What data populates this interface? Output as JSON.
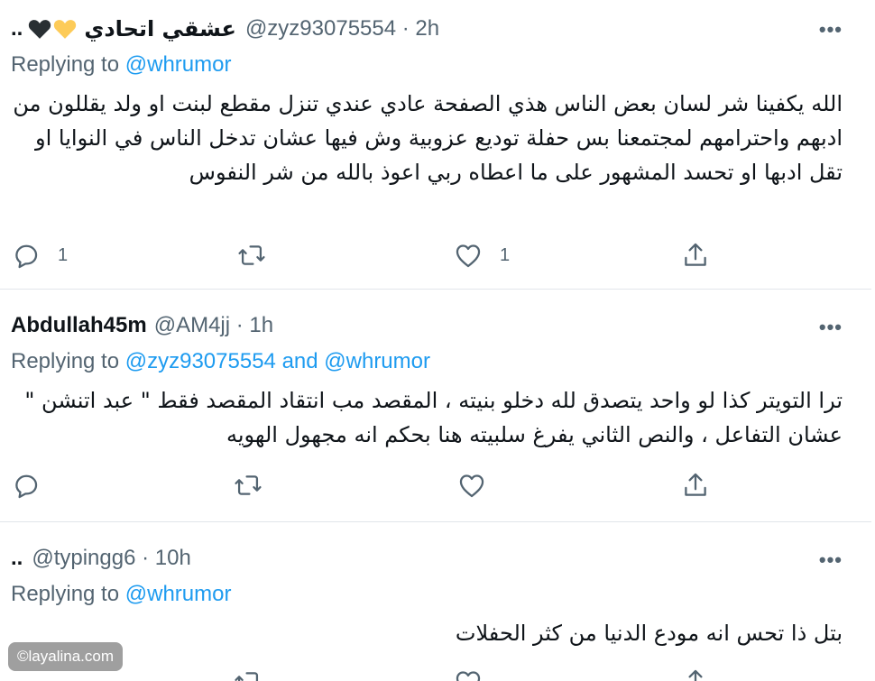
{
  "tweets": [
    {
      "display_prefix": "..",
      "name": "عشقي اتحادي",
      "handle_meta": "@zyz93075554 · 2h",
      "replying_prefix": "Replying to ",
      "replying_mentions": "@whrumor",
      "body": "الله يكفينا شر لسان بعض الناس هذي الصفحة عادي عندي تنزل مقطع لبنت او ولد يقللون من ادبهم واحترامهم لمجتمعنا بس حفلة توديع عزوبية وش فيها عشان تدخل الناس في النوايا او تقل ادبها او تحسد المشهور على ما اعطاه ربي اعوذ بالله من شر النفوس",
      "reply_count": "1",
      "like_count": "1"
    },
    {
      "name": "Abdullah45m",
      "handle_meta": "@AM4jj · 1h",
      "replying_prefix": "Replying to ",
      "replying_mentions": "@zyz93075554 and @whrumor",
      "body": "ترا التويتر كذا لو واحد يتصدق لله دخلو بنيته ، المقصد مب انتقاد المقصد فقط \" عبد اتنشن \" عشان التفاعل ، والنص الثاني يفرغ سلبيته هنا بحكم انه مجهول الهويه",
      "reply_count": "",
      "like_count": ""
    },
    {
      "display_prefix": "..",
      "handle_meta": "@typingg6 · 10h",
      "replying_prefix": "Replying to ",
      "replying_mentions": "@whrumor",
      "body": "بتل ذا تحس انه  مودع الدنيا من كثر الحفلات"
    }
  ],
  "more_label": "•••",
  "watermark": "©layalina.com",
  "icons": {
    "reply": "reply-icon",
    "retweet": "retweet-icon",
    "like": "heart-icon",
    "share": "share-icon"
  },
  "colors": {
    "accent": "#1d9bf0",
    "muted": "#536471",
    "divider": "#e1e6ea"
  }
}
